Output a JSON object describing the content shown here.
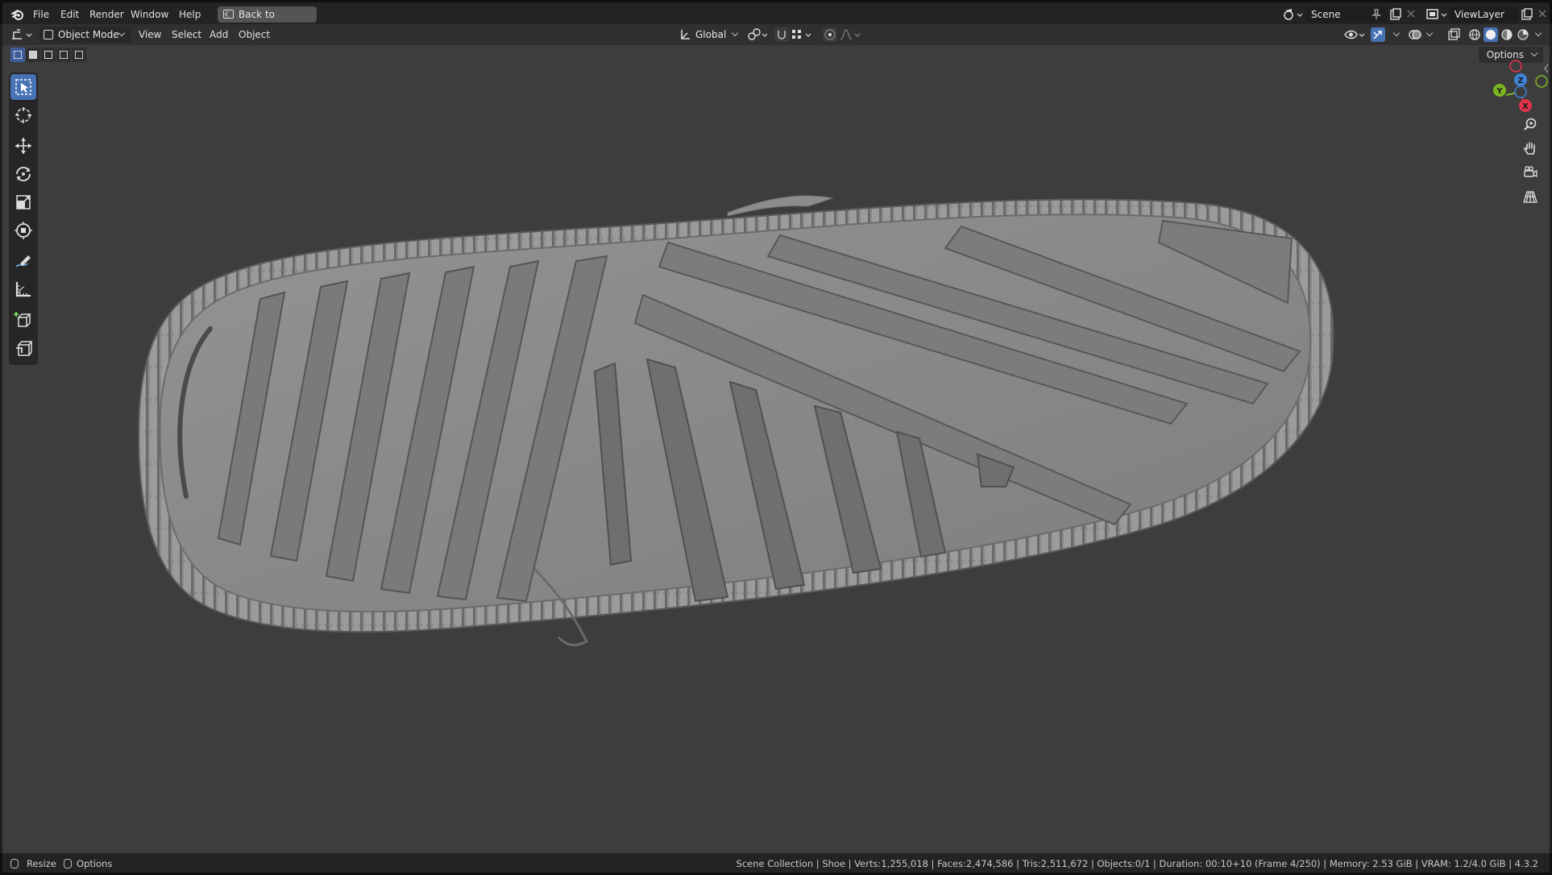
{
  "menu": {
    "items": [
      "File",
      "Edit",
      "Render",
      "Window",
      "Help"
    ],
    "back_button": "Back to Previous",
    "scene": "Scene",
    "view_layer": "ViewLayer"
  },
  "header": {
    "mode": "Object Mode",
    "menus": [
      "View",
      "Select",
      "Add",
      "Object"
    ],
    "transform_orientation": "Global",
    "options": "Options"
  },
  "toolbar": {
    "tools": [
      {
        "name": "select-box-tool",
        "icon": "select-box-icon",
        "active": true
      },
      {
        "name": "cursor-tool",
        "icon": "cursor-icon",
        "active": false
      },
      {
        "name": "move-tool",
        "icon": "move-icon",
        "active": false
      },
      {
        "name": "rotate-tool",
        "icon": "rotate-icon",
        "active": false
      },
      {
        "name": "scale-tool",
        "icon": "scale-icon",
        "active": false
      },
      {
        "name": "transform-tool",
        "icon": "transform-icon",
        "active": false
      },
      {
        "name": "annotate-tool",
        "icon": "annotate-icon",
        "active": false
      },
      {
        "name": "measure-tool",
        "icon": "measure-icon",
        "active": false
      },
      {
        "name": "add-cube-tool",
        "icon": "add-cube-icon",
        "active": false
      },
      {
        "name": "add-object-tool",
        "icon": "add-object-icon",
        "active": false
      }
    ]
  },
  "gizmo": {
    "axes": {
      "y": "Y",
      "z": "Z",
      "x": "X"
    },
    "colors": {
      "x": "#e0334c",
      "y": "#7db522",
      "z": "#3d83d6"
    }
  },
  "viewport": {
    "object": "Shoe",
    "mesh_color": "#8a8a8a"
  },
  "status": {
    "resize": "Resize",
    "options": "Options",
    "stats": "Scene Collection | Shoe | Verts:1,255,018 | Faces:2,474,586 | Tris:2,511,672 | Objects:0/1 | Duration: 00:10+10 (Frame 4/250) | Memory: 2.53 GiB | VRAM: 1.2/4.0 GiB | 4.3.2"
  }
}
